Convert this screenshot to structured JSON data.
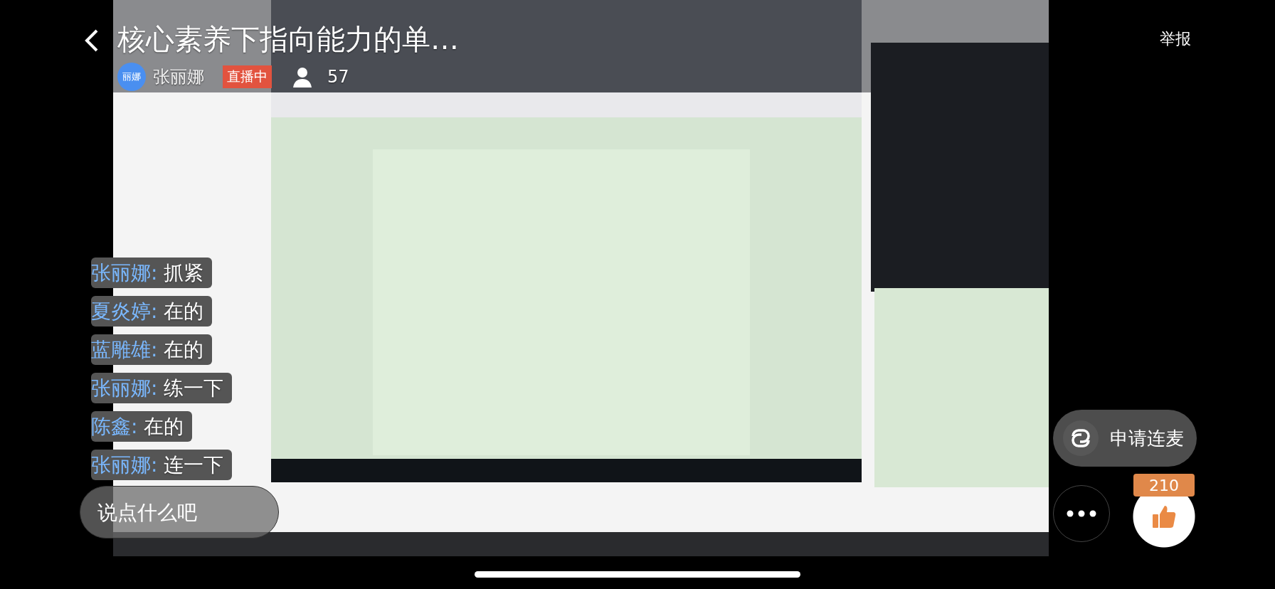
{
  "header": {
    "title": "核心素养下指向能力的单…",
    "avatar_text": "丽娜",
    "streamer_name": "张丽娜",
    "live_badge": "直播中",
    "viewer_count": "57",
    "report": "举报"
  },
  "chat": [
    {
      "user": "张丽娜:",
      "text": "抓紧"
    },
    {
      "user": "夏炎婷:",
      "text": "在的"
    },
    {
      "user": "蓝雕雄:",
      "text": "在的"
    },
    {
      "user": "张丽娜:",
      "text": "练一下"
    },
    {
      "user": "陈鑫:",
      "text": "在的"
    },
    {
      "user": "张丽娜:",
      "text": "连一下"
    }
  ],
  "comment_field": {
    "placeholder": "说点什么吧"
  },
  "link_mic_button": "申请连麦",
  "like_count": "210"
}
